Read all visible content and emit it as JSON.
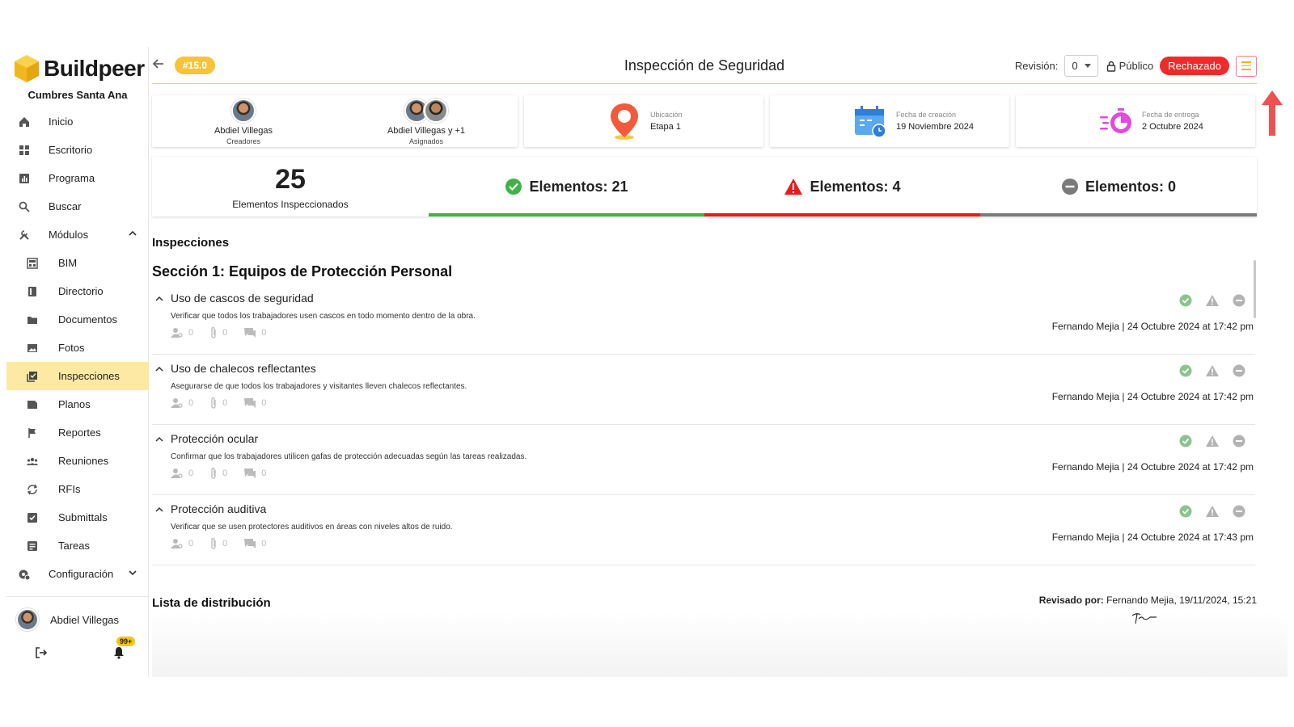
{
  "brand": {
    "name": "Buildpeer",
    "project": "Cumbres Santa Ana"
  },
  "nav": [
    {
      "label": "Inicio",
      "icon": "home-icon"
    },
    {
      "label": "Escritorio",
      "icon": "dashboard-icon"
    },
    {
      "label": "Programa",
      "icon": "chart-icon"
    },
    {
      "label": "Buscar",
      "icon": "search-icon"
    },
    {
      "label": "Módulos",
      "icon": "tools-icon"
    }
  ],
  "modules": [
    {
      "label": "BIM",
      "icon": "bim-icon"
    },
    {
      "label": "Directorio",
      "icon": "book-icon"
    },
    {
      "label": "Documentos",
      "icon": "folder-icon"
    },
    {
      "label": "Fotos",
      "icon": "photo-icon"
    },
    {
      "label": "Inspecciones",
      "icon": "checklist-icon",
      "active": true
    },
    {
      "label": "Planos",
      "icon": "map-icon"
    },
    {
      "label": "Reportes",
      "icon": "flag-icon"
    },
    {
      "label": "Reuniones",
      "icon": "group-icon"
    },
    {
      "label": "RFIs",
      "icon": "sync-icon"
    },
    {
      "label": "Submittals",
      "icon": "checkbox-icon"
    },
    {
      "label": "Tareas",
      "icon": "task-icon"
    }
  ],
  "config": {
    "label": "Configuración",
    "icon": "settings-icon"
  },
  "user": {
    "name": "Abdiel Villegas",
    "notifications": "99+"
  },
  "header": {
    "id_badge": "#15.0",
    "title": "Inspección de Seguridad",
    "revision_label": "Revisión:",
    "revision_value": "0",
    "visibility": "Público",
    "status": "Rechazado"
  },
  "people": [
    {
      "name": "Abdiel Villegas",
      "role": "Creadores"
    },
    {
      "name": "Abdiel Villegas y +1",
      "role": "Asignados"
    }
  ],
  "info_cards": [
    {
      "label": "Ubicación",
      "value": "Etapa 1",
      "icon": "location-pin-icon"
    },
    {
      "label": "Fecha de creación",
      "value": "19 Noviembre 2024",
      "icon": "calendar-icon"
    },
    {
      "label": "Fecha de entrega",
      "value": "2 Octubre 2024",
      "icon": "timer-icon"
    }
  ],
  "stats": {
    "total": "25",
    "total_caption": "Elementos Inspeccionados",
    "ok": "Elementos: 21",
    "warning": "Elementos: 4",
    "na": "Elementos: 0",
    "colors": {
      "ok": "#3fb349",
      "warning": "#e81b1b",
      "na": "#7a7a7a"
    }
  },
  "inspections": {
    "heading": "Inspecciones",
    "section_title": "Sección 1: Equipos de Protección Personal",
    "items": [
      {
        "title": "Uso de cascos de seguridad",
        "desc": "Verificar que todos los trabajadores usen cascos en todo momento dentro de la obra.",
        "assignees": "0",
        "attachments": "0",
        "comments": "0",
        "meta": "Fernando Mejia | 24 Octubre 2024 at 17:42 pm"
      },
      {
        "title": "Uso de chalecos reflectantes",
        "desc": "Asegurarse de que todos los trabajadores y visitantes lleven chalecos reflectantes.",
        "assignees": "0",
        "attachments": "0",
        "comments": "0",
        "meta": "Fernando Mejia | 24 Octubre 2024 at 17:42 pm"
      },
      {
        "title": "Protección ocular",
        "desc": "Confirmar que los trabajadores utilicen gafas de protección adecuadas según las tareas realizadas.",
        "assignees": "0",
        "attachments": "0",
        "comments": "0",
        "meta": "Fernando Mejia | 24 Octubre 2024 at 17:42 pm"
      },
      {
        "title": "Protección auditiva",
        "desc": "Verificar que se usen protectores auditivos en áreas con niveles altos de ruido.",
        "assignees": "0",
        "attachments": "0",
        "comments": "0",
        "meta": "Fernando Mejia | 24 Octubre 2024 at 17:43 pm"
      }
    ]
  },
  "distribution": {
    "heading": "Lista de distribución"
  },
  "review": {
    "label": "Revisado por:",
    "value": "Fernando Mejia, 19/11/2024, 15:21"
  }
}
